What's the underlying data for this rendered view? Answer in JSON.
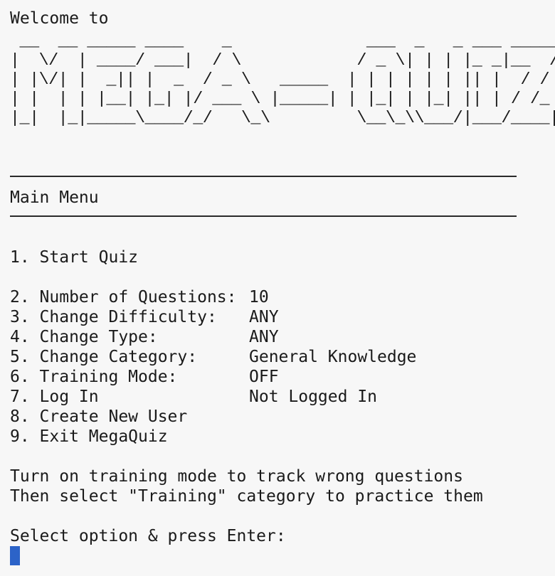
{
  "welcome": "Welcome to",
  "banner": " __  __ _____ ____    _              ___  _   _ ___ _____\n|  \\/  | ____/ ___|  / \\            / _ \\| | | |_ _|__  /\n| |\\/| |  _|| |  _  / _ \\   _____  | | | | | | || |  / / \n| |  | | |__| |_| |/ ___ \\ |_____| | |_| | |_| || | / /_ \n|_|  |_|_____\\____/_/   \\_\\         \\__\\_\\\\___/|___/____|",
  "menu_title": "Main Menu",
  "menu": [
    {
      "label": "1. Start Quiz",
      "value": ""
    },
    {
      "label": "2. Number of Questions:",
      "value": "10"
    },
    {
      "label": "3. Change Difficulty:",
      "value": "ANY"
    },
    {
      "label": "4. Change Type:",
      "value": "ANY"
    },
    {
      "label": "5. Change Category:",
      "value": "General Knowledge"
    },
    {
      "label": "6. Training Mode:",
      "value": "OFF"
    },
    {
      "label": "7. Log In",
      "value": "Not Logged In"
    },
    {
      "label": "8. Create New User",
      "value": ""
    },
    {
      "label": "9. Exit MegaQuiz",
      "value": ""
    }
  ],
  "hints": [
    "Turn on training mode to track wrong questions",
    "Then select \"Training\" category to practice them"
  ],
  "prompt": "Select option & press Enter:",
  "colors": {
    "background": "#f7f7f7",
    "text": "#1a1a1a",
    "cursor": "#2c63c8"
  }
}
